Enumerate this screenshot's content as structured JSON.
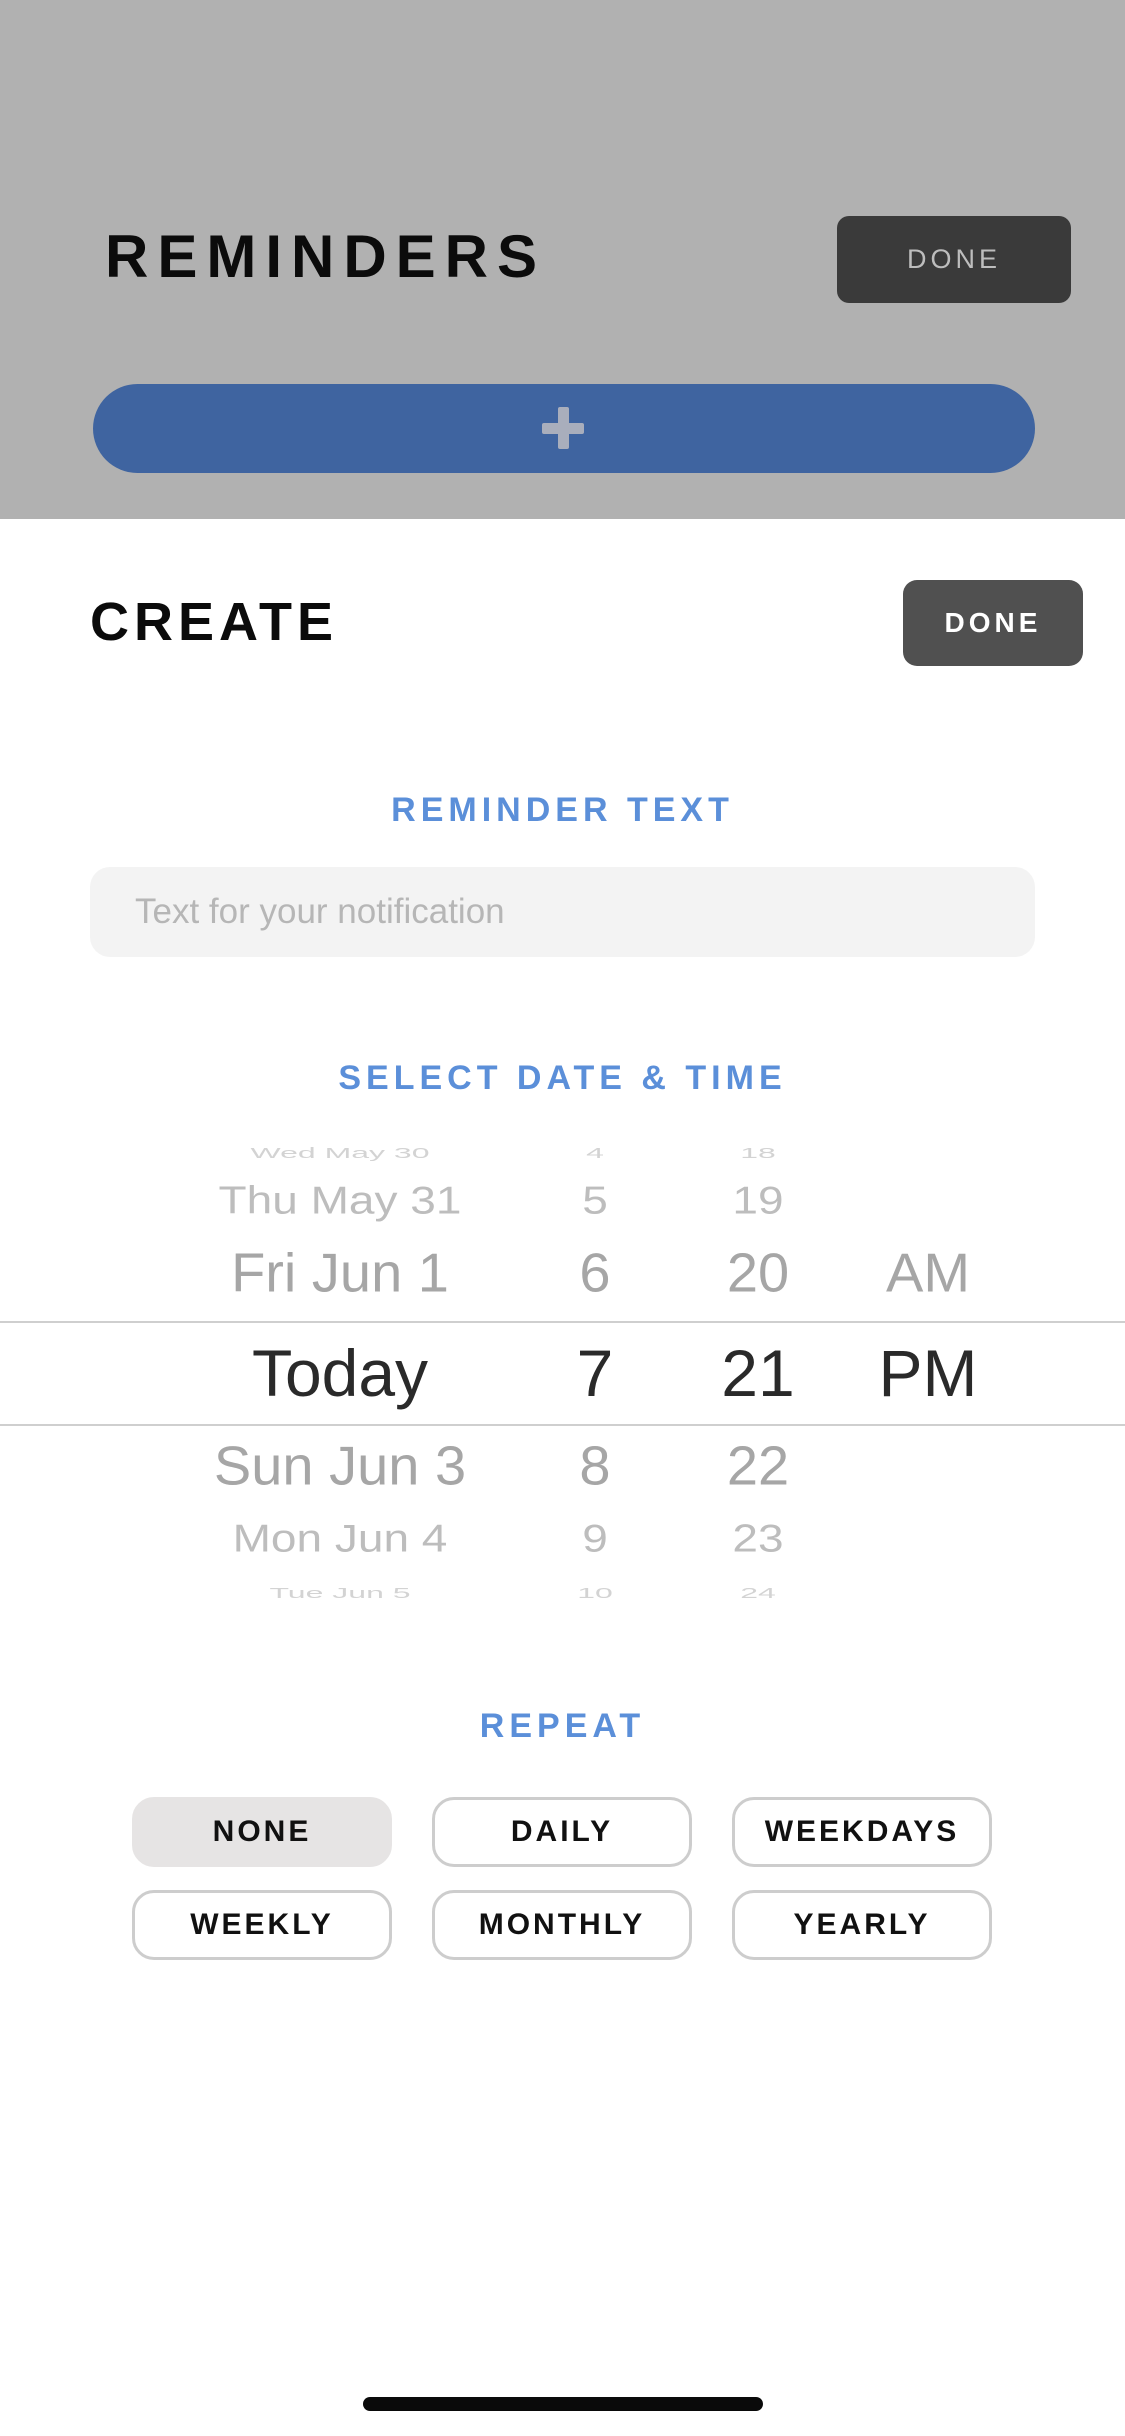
{
  "background_screen": {
    "title": "REMINDERS",
    "done_label": "DONE",
    "add_button_icon": "plus-icon"
  },
  "sheet": {
    "title": "CREATE",
    "done_label": "DONE",
    "reminder_text_label": "REMINDER TEXT",
    "reminder_text_placeholder": "Text for your notification",
    "reminder_text_value": "",
    "datetime_label": "SELECT DATE & TIME",
    "picker": {
      "rows": [
        {
          "date": "Wed May 30",
          "hour": "4",
          "minute": "18",
          "ampm": ""
        },
        {
          "date": "Thu May 31",
          "hour": "5",
          "minute": "19",
          "ampm": ""
        },
        {
          "date": "Fri Jun 1",
          "hour": "6",
          "minute": "20",
          "ampm": "AM"
        },
        {
          "date": "Today",
          "hour": "7",
          "minute": "21",
          "ampm": "PM"
        },
        {
          "date": "Sun Jun 3",
          "hour": "8",
          "minute": "22",
          "ampm": ""
        },
        {
          "date": "Mon Jun 4",
          "hour": "9",
          "minute": "23",
          "ampm": ""
        },
        {
          "date": "Tue Jun 5",
          "hour": "10",
          "minute": "24",
          "ampm": ""
        }
      ]
    },
    "repeat_label": "REPEAT",
    "repeat_options": [
      "NONE",
      "DAILY",
      "WEEKDAYS",
      "WEEKLY",
      "MONTHLY",
      "YEARLY"
    ],
    "repeat_selected": "NONE"
  },
  "colors": {
    "accent_blue": "#5b8fd9",
    "add_bar": "#3f64a0",
    "backdrop": "#b1b1b1"
  }
}
